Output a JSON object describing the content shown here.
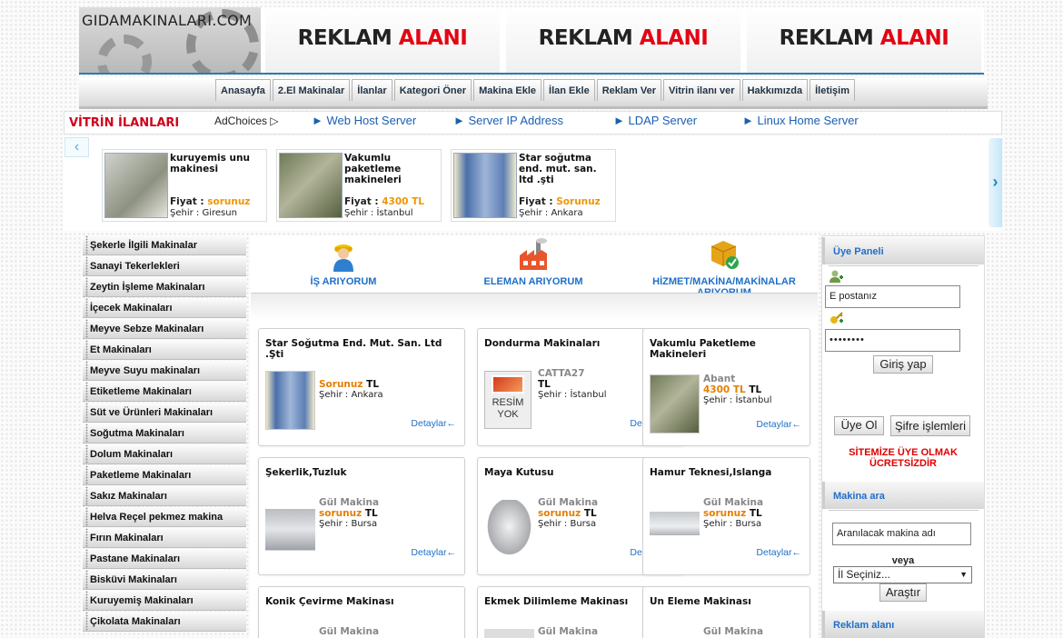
{
  "header": {
    "logo_text": "GIDAMAKINALARI.COM",
    "ads": [
      {
        "w1": "REKLAM",
        "w2": "ALANI"
      },
      {
        "w1": "REKLAM",
        "w2": "ALANI"
      },
      {
        "w1": "REKLAM",
        "w2": "ALANI"
      }
    ]
  },
  "nav": [
    "Anasayfa",
    "2.El Makinalar",
    "İlanlar",
    "Kategori Öner",
    "Makina Ekle",
    "İlan Ekle",
    "Reklam Ver",
    "Vitrin ilanı ver",
    "Hakkımızda",
    "İletişim"
  ],
  "vitrin": {
    "title": "VİTRİN İLANLARI",
    "adchoices": "AdChoices ▷",
    "ad_links": [
      "► Web Host Server",
      "► Server IP Address",
      "► LDAP Server",
      "► Linux Home Server"
    ],
    "items": [
      {
        "title": "kuruyemis unu makinesi",
        "fiyat_label": "Fiyat :",
        "fiyat": "sorunuz",
        "city_label": "Şehir :",
        "city": "Giresun"
      },
      {
        "title": "Vakumlu paketleme makineleri",
        "fiyat_label": "Fiyat :",
        "fiyat": "4300 TL",
        "city_label": "Şehir :",
        "city": "İstanbul"
      },
      {
        "title": "Star soğutma end. mut. san. ltd .şti",
        "fiyat_label": "Fiyat :",
        "fiyat": "Sorunuz",
        "city_label": "Şehir :",
        "city": "Ankara"
      }
    ]
  },
  "categories": [
    "Şekerle İlgili Makinalar",
    "Sanayi Tekerlekleri",
    "Zeytin İşleme Makinaları",
    "İçecek Makinaları",
    "Meyve Sebze Makinaları",
    "Et Makinaları",
    "Meyve Suyu makinaları",
    "Etiketleme Makinaları",
    "Süt ve Ürünleri Makinaları",
    "Soğutma Makinaları",
    "Dolum Makinaları",
    "Paketleme Makinaları",
    "Sakız Makinaları",
    "Helva Reçel pekmez makina",
    "Fırın Makinaları",
    "Pastane Makinaları",
    "Bisküvi Makinaları",
    "Kuruyemiş Makinaları",
    "Çikolata Makinaları"
  ],
  "features": [
    "İŞ ARIYORUM",
    "ELEMAN ARIYORUM",
    "HİZMET/MAKİNA/MAKİNALAR ARIYORUM"
  ],
  "listings": [
    {
      "title": "Star Soğutma End. Mut. San. Ltd .Şti",
      "firm": "",
      "price": "Sorunuz",
      "tl": "TL",
      "city_label": "Şehir :",
      "city": "Ankara",
      "details": "Detaylar←"
    },
    {
      "title": "Dondurma Makinaları",
      "firm": "CATTA27",
      "price": "",
      "tl": "TL",
      "city_label": "Şehir :",
      "city": "İstanbul",
      "details": "Detaylar←",
      "img_text": "RESİM YOK"
    },
    {
      "title": "Vakumlu Paketleme Makineleri",
      "firm": "Abant",
      "price": "4300 TL",
      "tl": "TL",
      "city_label": "Şehir :",
      "city": "İstanbul",
      "details": "Detaylar←"
    },
    {
      "title": "Şekerlik,Tuzluk",
      "firm": "Gül Makina",
      "price": "sorunuz",
      "tl": "TL",
      "city_label": "Şehir :",
      "city": "Bursa",
      "details": "Detaylar←"
    },
    {
      "title": "Maya Kutusu",
      "firm": "Gül Makina",
      "price": "sorunuz",
      "tl": "TL",
      "city_label": "Şehir :",
      "city": "Bursa",
      "details": "Detaylar←"
    },
    {
      "title": "Hamur Teknesi,Islanga",
      "firm": "Gül Makina",
      "price": "sorunuz",
      "tl": "TL",
      "city_label": "Şehir :",
      "city": "Bursa",
      "details": "Detaylar←"
    },
    {
      "title": "Konik Çevirme Makinası",
      "firm": "Gül Makina"
    },
    {
      "title": "Ekmek Dilimleme Makinası",
      "firm": "Gül Makina"
    },
    {
      "title": "Un Eleme Makinası",
      "firm": "Gül Makina"
    }
  ],
  "member": {
    "title": "Üye Paneli",
    "email_value": "E postanız",
    "password_value": "••••••••",
    "login": "Giriş yap",
    "signup": "Üye Ol",
    "forgot": "Şifre işlemleri",
    "free": "SİTEMİZE ÜYE OLMAK ÜCRETSİZDİR"
  },
  "search": {
    "title": "Makina ara",
    "input_value": "Aranılacak makina adı",
    "or": "veya",
    "select": "İl Seçiniz...",
    "button": "Araştır"
  },
  "ads_title": "Reklam alanı"
}
